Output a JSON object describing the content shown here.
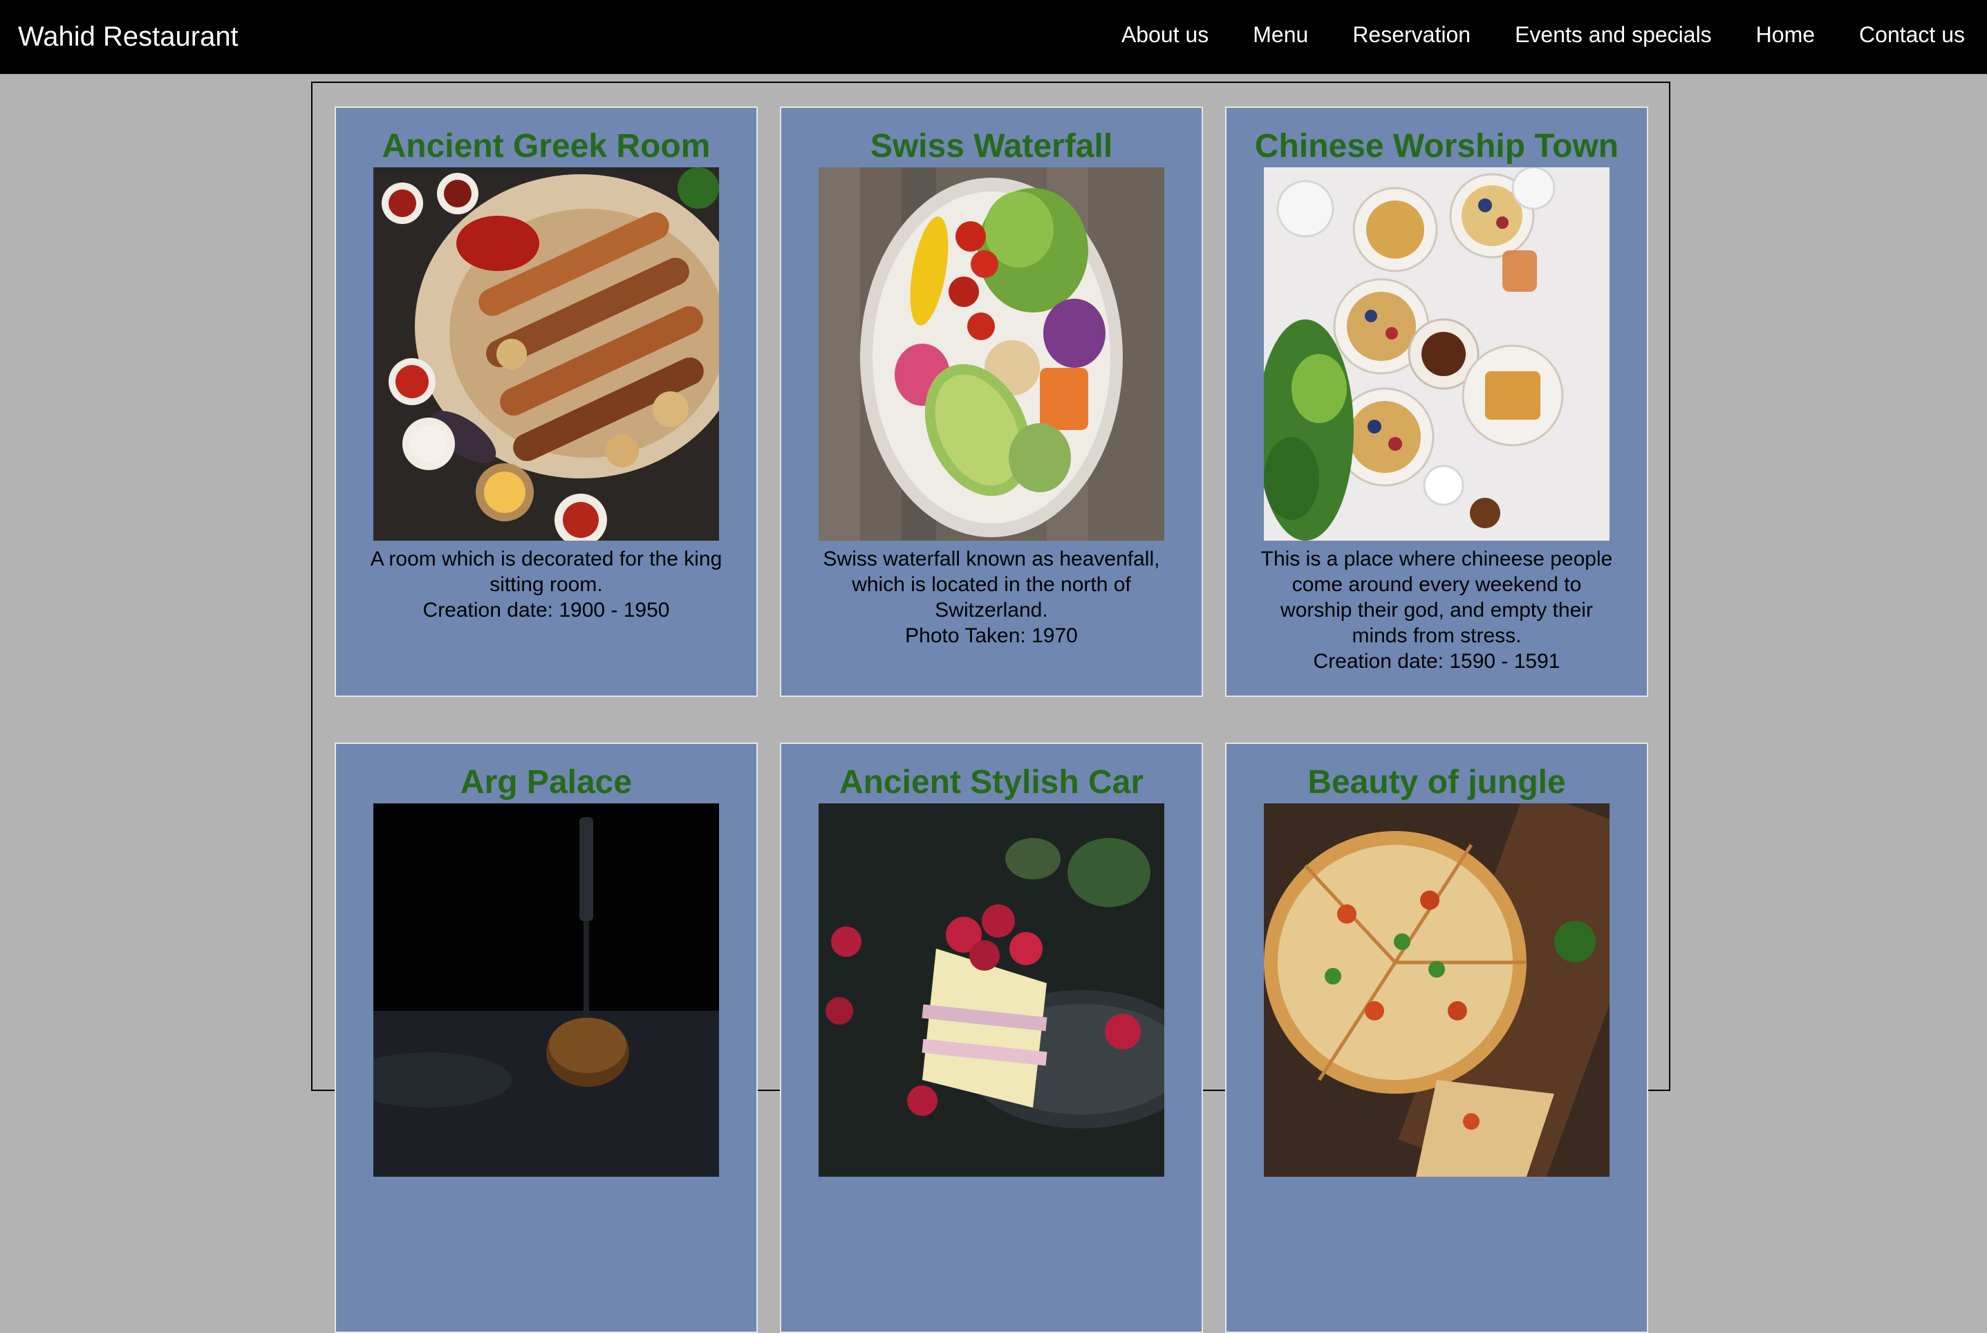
{
  "brand": "Wahid Restaurant",
  "nav": [
    "About us",
    "Menu",
    "Reservation",
    "Events and specials",
    "Home",
    "Contact us"
  ],
  "colors": {
    "navbar_bg": "#000000",
    "page_bg": "#b3b3b3",
    "card_bg": "#6f87b1",
    "card_title": "#266a19"
  },
  "cards": [
    {
      "title": "Ancient Greek Room",
      "image": "grilled-meats-platter-photo",
      "desc": [
        "A room which is decorated for the king sitting room.",
        "Creation date: 1900 - 1950"
      ]
    },
    {
      "title": "Swiss Waterfall",
      "image": "salad-bowl-photo",
      "desc": [
        "Swiss waterfall known as heavenfall, which is located in the north of Switzerland.",
        "Photo Taken: 1970"
      ]
    },
    {
      "title": "Chinese Worship Town",
      "image": "breakfast-bowls-photo",
      "desc": [
        "This is a place where chineese people come around every weekend to worship their god, and empty their minds from stress.",
        "Creation date: 1590 - 1591"
      ]
    },
    {
      "title": "Arg Palace",
      "image": "burger-with-knife-photo",
      "desc": []
    },
    {
      "title": "Ancient Stylish Car",
      "image": "raspberry-cake-photo",
      "desc": []
    },
    {
      "title": "Beauty of jungle",
      "image": "pizza-on-board-photo",
      "desc": []
    }
  ]
}
